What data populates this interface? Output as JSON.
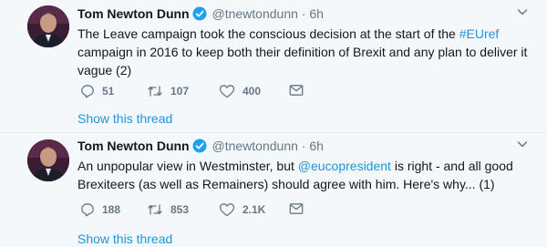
{
  "tweets": [
    {
      "name": "Tom Newton Dunn",
      "handle": "@tnewtondunn",
      "dot": "·",
      "time": "6h",
      "text_before": "The Leave campaign took the conscious decision at the start of the ",
      "hashtag": "#EUref",
      "text_after": " campaign in 2016 to keep both their definition of Brexit and any plan to deliver it vague (2)",
      "replies": "51",
      "retweets": "107",
      "likes": "400",
      "show_thread": "Show this thread"
    },
    {
      "name": "Tom Newton Dunn",
      "handle": "@tnewtondunn",
      "dot": "·",
      "time": "6h",
      "text_before": "An unpopular view in Westminster, but ",
      "mention": "@eucopresident",
      "text_after": " is right - and all good Brexiteers (as well as Remainers) should agree with him. Here's why... (1)",
      "replies": "188",
      "retweets": "853",
      "likes": "2.1K",
      "show_thread": "Show this thread"
    }
  ],
  "colors": {
    "background": "#f5f8fa",
    "text": "#14171a",
    "secondary": "#657786",
    "link": "#1b95e0",
    "verified": "#1da1f2"
  },
  "icons": [
    "verified-badge-icon",
    "chevron-down-icon",
    "reply-icon",
    "retweet-icon",
    "like-icon",
    "message-icon"
  ]
}
